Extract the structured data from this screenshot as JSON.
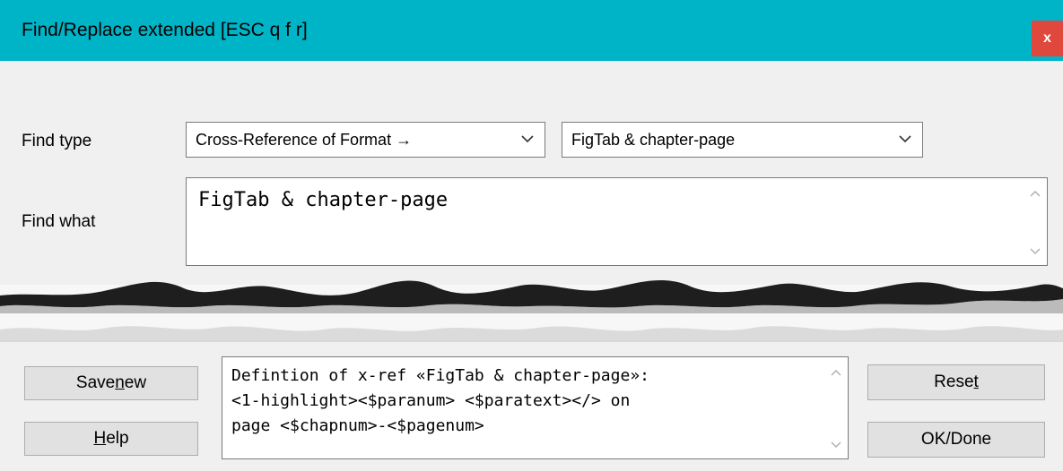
{
  "window": {
    "title": "Find/Replace extended [ESC q f r]",
    "close_label": "x"
  },
  "find_type": {
    "label": "Find type",
    "primary_value": "Cross-Reference of Format →",
    "secondary_value": "FigTab & chapter-page"
  },
  "find_what": {
    "label": "Find what",
    "value": "FigTab & chapter-page"
  },
  "buttons": {
    "save_new": {
      "before": "Save ",
      "mnemonic": "n",
      "after": "ew"
    },
    "help": {
      "before": "",
      "mnemonic": "H",
      "after": "elp"
    },
    "reset": {
      "before": "Rese",
      "mnemonic": "t",
      "after": ""
    },
    "ok_done": "OK/Done"
  },
  "definition": {
    "lines": [
      "Defintion of x-ref «FigTab & chapter-page»:",
      "<1-highlight><$paranum> <$paratext></> on",
      "page <$chapnum>‑<$pagenum>"
    ]
  },
  "colors": {
    "titlebar": "#00b4c8",
    "close_button": "#e0483e",
    "dialog_background": "#f0f0f0"
  },
  "icons": {
    "close": "close-icon",
    "dropdown": "chevron-down-icon",
    "scroll_up": "chevron-up-icon",
    "scroll_down": "chevron-down-icon"
  }
}
